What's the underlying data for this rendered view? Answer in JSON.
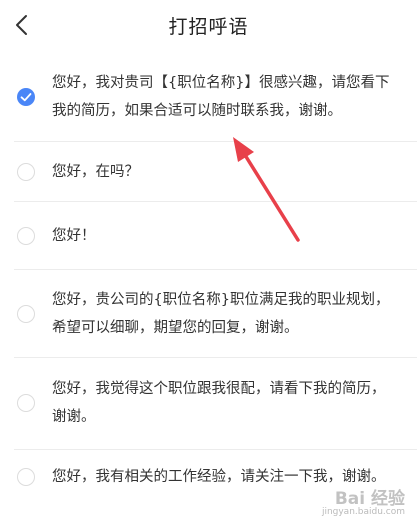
{
  "header": {
    "title": "打招呼语",
    "back_icon": "chevron-left-icon"
  },
  "greetings": [
    {
      "text": "您好，我对贵司【{职位名称}】很感兴趣，请您看下我的简历，如果合适可以随时联系我，谢谢。",
      "selected": true
    },
    {
      "text": "您好，在吗？",
      "selected": false
    },
    {
      "text": "您好！",
      "selected": false
    },
    {
      "text": "您好，贵公司的{职位名称}职位满足我的职业规划，希望可以细聊，期望您的回复，谢谢。",
      "selected": false
    },
    {
      "text": "您好，我觉得这个职位跟我很配，请看下我的简历，谢谢。",
      "selected": false
    },
    {
      "text": "您好，我有相关的工作经验，请关注一下我，谢谢。",
      "selected": false
    }
  ],
  "colors": {
    "accent": "#4a86f7",
    "annotation_arrow": "#e8404a"
  },
  "watermark": {
    "brand": "Bai 经验",
    "url": "jingyan.baidu.com"
  }
}
